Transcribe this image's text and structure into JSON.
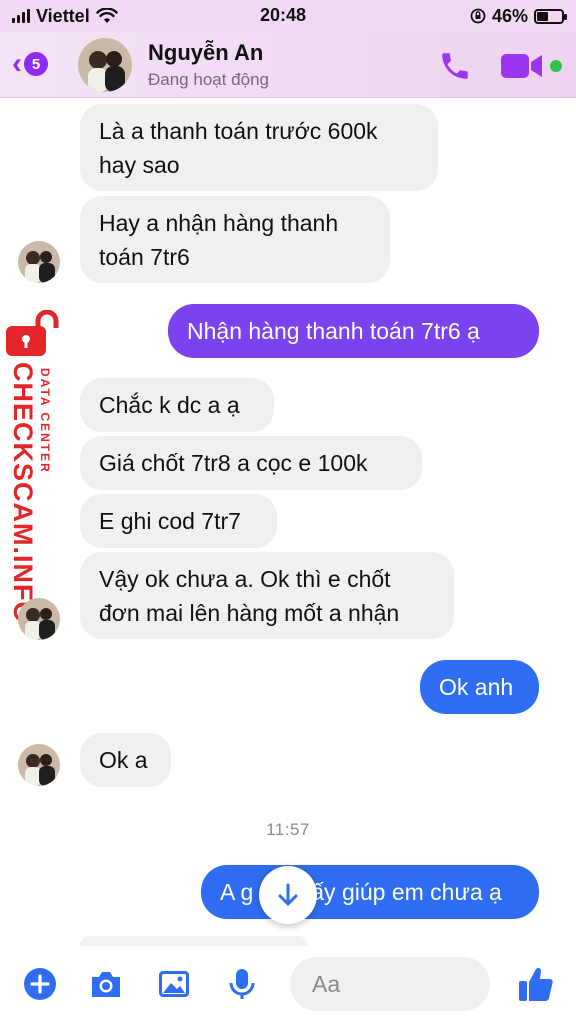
{
  "status_bar": {
    "carrier": "Viettel",
    "time": "20:48",
    "battery_percent": "46%",
    "battery_level": 0.46
  },
  "header": {
    "back_count": "5",
    "contact_name": "Nguyễn An",
    "presence": "Đang hoạt động"
  },
  "watermark": {
    "big_text": "CHECKSCAM.INFO",
    "small_text": "DATA CENTER"
  },
  "messages": [
    {
      "dir": "in",
      "text_lines": [
        "Là a thanh toán trước 600k",
        "hay sao"
      ]
    },
    {
      "dir": "in",
      "text_lines": [
        "Hay a nhận hàng thanh",
        "toán 7tr6"
      ]
    },
    {
      "dir": "out",
      "text_lines": [
        "Nhận hàng thanh toán 7tr6 ạ"
      ]
    },
    {
      "dir": "in",
      "text_lines": [
        "Chắc k dc a ạ"
      ]
    },
    {
      "dir": "in",
      "text_lines": [
        "Giá chốt 7tr8 a cọc e 100k"
      ]
    },
    {
      "dir": "in",
      "text_lines": [
        "E ghi cod 7tr7"
      ]
    },
    {
      "dir": "in",
      "text_lines": [
        "Vậy ok chưa a. Ok thì e chốt",
        "đơn mai lên hàng mốt a nhận"
      ]
    },
    {
      "dir": "out",
      "text_lines": [
        "Ok anh"
      ]
    },
    {
      "dir": "in",
      "text_lines": [
        "Ok a"
      ]
    },
    {
      "dir": "out",
      "text_lines": [
        "A g",
        "ấy giúp em chưa ạ"
      ]
    }
  ],
  "timestamp": "11:57",
  "composer": {
    "placeholder": "Aa"
  },
  "colors": {
    "accent": "#8b2cf0",
    "outgoing_purple": "#7b43f0",
    "outgoing_blue": "#2f6ef2",
    "incoming": "#f0f0f0",
    "watermark_red": "#e3262a",
    "online_green": "#31c24d"
  },
  "icons": {
    "back": "chevron-left-icon",
    "call": "phone-icon",
    "video": "video-camera-icon",
    "plus": "plus-circle-icon",
    "camera": "camera-icon",
    "gallery": "image-icon",
    "mic": "microphone-icon",
    "emoji": "smiley-icon",
    "like": "thumbs-up-icon",
    "scroll": "arrow-down-icon",
    "lock": "padlock-icon"
  }
}
